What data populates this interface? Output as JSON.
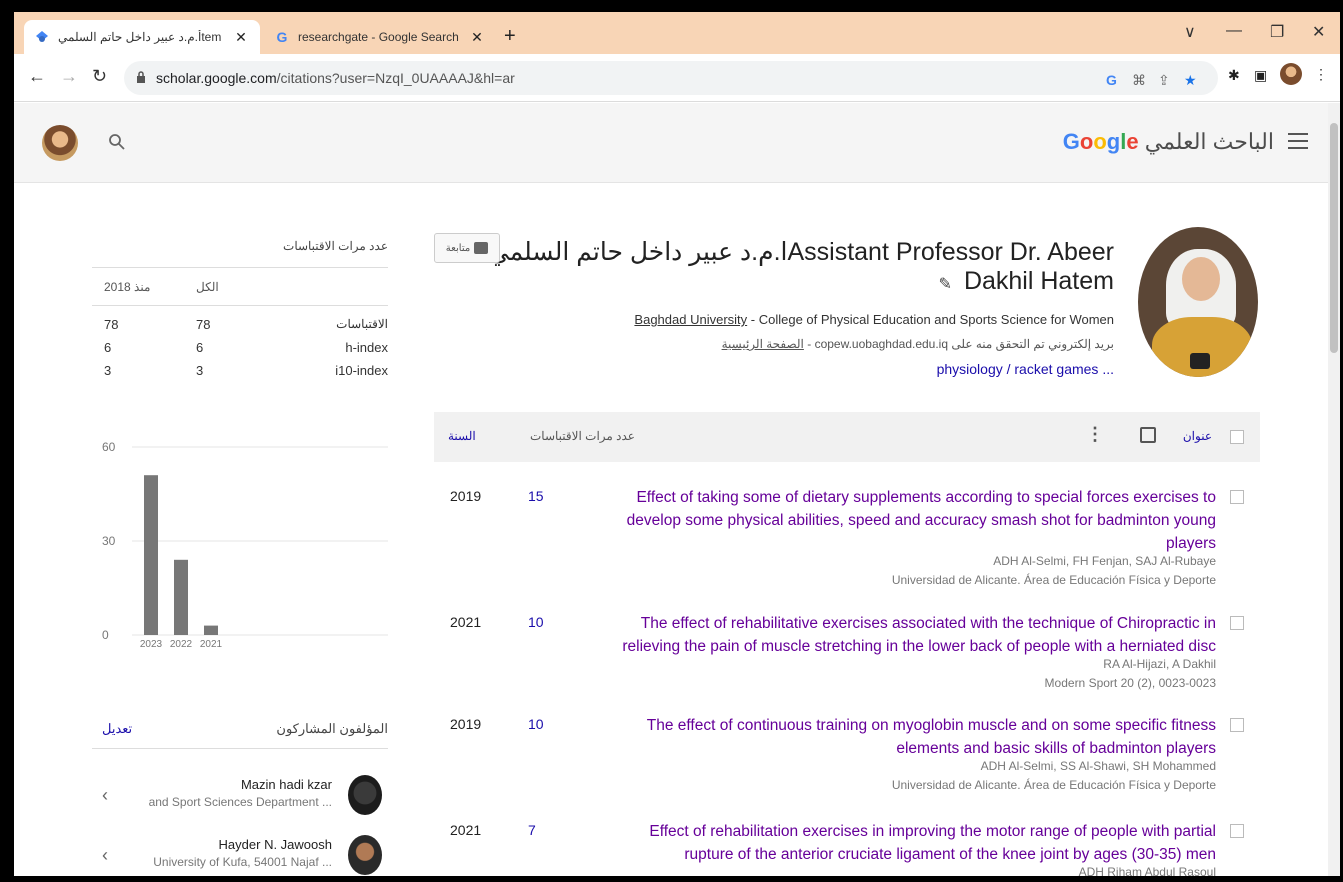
{
  "browser": {
    "tabs": [
      {
        "title": "أ.م.د عبير داخل حاتم السلمي‏ - ‪Google‬ ‪Scholar‬",
        "display": "‏أ.م.د عبير داخل حاتم السلمي‏tem",
        "close": "✕",
        "active": true
      },
      {
        "title": "researchgate - Google Search",
        "display": "researchgate - Google Search",
        "close": "✕",
        "active": false
      }
    ],
    "new_tab": "+",
    "window_controls": {
      "minimize": "—",
      "restore": "❐",
      "close": "✕",
      "dropdown": "∨"
    },
    "url_domain": "scholar.google.com",
    "url_path": "/citations?user=NzqI_0UAAAAJ&hl=ar"
  },
  "header": {
    "logo_google": "Google",
    "logo_scholar": "الباحث العلمي"
  },
  "profile": {
    "name_line1": "ا.م.د عبير داخل حاتم السلميAssistant Professor Dr. Abeer",
    "name_line2": "Dakhil Hatem",
    "affiliation_link": "Baghdad University",
    "affiliation_rest": " - College of Physical Education and Sports Science for Women",
    "email_text": "بريد إلكتروني تم التحقق منه على copew.uobaghdad.edu.iq - ",
    "homepage": "الصفحة الرئيسية",
    "interests": "physiology / racket games ...",
    "follow_label": "متابعة"
  },
  "cited_by": {
    "title": "عدد مرات الاقتباسات",
    "col_all": "الكل",
    "col_since": "منذ 2018",
    "rows": [
      {
        "label": "الاقتباسات",
        "all": "78",
        "since": "78"
      },
      {
        "label": "h-index",
        "all": "6",
        "since": "6"
      },
      {
        "label": "i10-index",
        "all": "3",
        "since": "3"
      }
    ]
  },
  "chart_data": {
    "type": "bar",
    "categories": [
      "2023",
      "2022",
      "2021"
    ],
    "values": [
      51,
      24,
      3
    ],
    "ylim": [
      0,
      60
    ],
    "yticks": [
      "60",
      "30",
      "0"
    ],
    "bar_color": "#777777",
    "grid": true
  },
  "coauthors": {
    "title": "المؤلفون المشاركون",
    "edit": "تعديل",
    "items": [
      {
        "name": "Mazin hadi kzar",
        "affiliation": "and Sport Sciences Department ..."
      },
      {
        "name": "Hayder N. Jawoosh",
        "affiliation": "University of Kufa, 54001 Najaf ..."
      }
    ]
  },
  "articles": {
    "header": {
      "title": "عنوان",
      "cited": "عدد مرات الاقتباسات",
      "year": "السنة"
    },
    "items": [
      {
        "title": "Effect of taking some of dietary supplements according to special forces exercises to develop some physical abilities, speed and accuracy smash shot for badminton young players",
        "authors": "ADH Al-Selmi, FH Fenjan, SAJ Al-Rubaye",
        "venue": "Universidad de Alicante. Área de Educación Física y Deporte",
        "cited": "15",
        "year": "2019"
      },
      {
        "title": "The effect of rehabilitative exercises associated with the technique of Chiropractic in relieving the pain of muscle stretching in the lower back of people with a herniated disc",
        "authors": "RA Al-Hijazi, A Dakhil",
        "venue": "Modern Sport 20 (2), 0023-0023",
        "cited": "10",
        "year": "2021"
      },
      {
        "title": "The effect of continuous training on myoglobin muscle and on some specific fitness elements and basic skills of badminton players",
        "authors": "ADH Al-Selmi, SS Al-Shawi, SH Mohammed",
        "venue": "Universidad de Alicante. Área de Educación Física y Deporte",
        "cited": "10",
        "year": "2019"
      },
      {
        "title": "Effect of rehabilitation exercises in improving the motor range of people with partial rupture of the anterior cruciate ligament of the knee joint by ages (30-35) men",
        "authors": "ADH Riham Abdul Rasoul",
        "venue": "",
        "cited": "7",
        "year": "2021"
      }
    ]
  }
}
